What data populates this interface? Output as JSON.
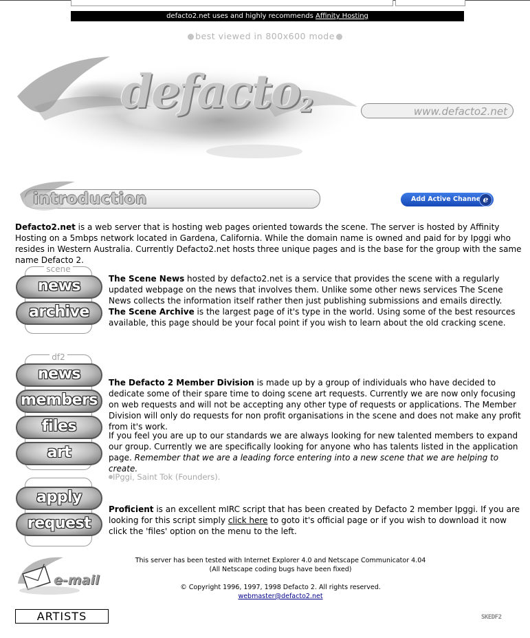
{
  "sponsor": {
    "text": "defacto2.net uses and highly recommends ",
    "link": "Affinity Hosting"
  },
  "best_viewed": "best viewed in 800x600 mode",
  "header": {
    "logo": "defacto",
    "logo_sub": "2",
    "url": "www.defacto2.net"
  },
  "intro": {
    "heading": "introduction",
    "channel_button": "Add Active Channel",
    "channel_icon": "e"
  },
  "intro_para": {
    "bold": "Defacto2.net",
    "text": " is a web server that is hosting web pages oriented towards the scene. The server is hosted by Affinity Hosting on a 5mbps network located in Gardena, California. While the domain name is owned and paid for by Ipggi who resides in Western Australia. Currently Defacto2.net hosts three unique pages and is the base for the group with the same name Defacto 2."
  },
  "nav": {
    "scene_label": "scene",
    "df2_label": "df2",
    "scene_news": "news",
    "scene_archive": "archive",
    "df2_news": "news",
    "df2_members": "members",
    "df2_files": "files",
    "df2_art": "art",
    "apply": "apply",
    "request": "request"
  },
  "scene": {
    "news_bold": "The Scene News",
    "news_text": " hosted by defacto2.net is a service that provides the scene with a regularly updated webpage on the news that involves them. Unlike some other news services The Scene News collects the information itself rather then just publishing submissions and emails directly.",
    "archive_bold": "The Scene Archive",
    "archive_text": " is the largest page of it's type in the world. Using some of the best resources available, this page should be your focal point if you wish to learn about the old cracking scene."
  },
  "df2": {
    "member_bold": "The Defacto 2 Member Division",
    "member_text": " is made up by a group of individuals who have decided to dedicate some of their spare time to doing scene art requests. Currently we are now only focusing on web requests and will not be accepting any other type of requests or applications. The Member Division will only do requests for non profit organisations in the scene and does not make any profit from it's work.",
    "standards_text": "If you feel you are up to our standards we are always looking for new talented members to expand our group. Currently we are specifically looking for anyone who has talents listed in the application page.",
    "standards_italic": "Remember that we are a leading force entering into a new scene that we are helping to create.",
    "founders": "IPggi, Saint Tok (Founders)."
  },
  "proficient": {
    "bold": "Proficient",
    "text1": " is an excellent mIRC script that has been created by Defacto 2 member Ipggi. If you are looking for this script simply ",
    "link": "click here",
    "text2": " to goto it's official page or if you wish to download it now click the 'files' option on the menu to the left."
  },
  "email_label": "e-mail",
  "footer": {
    "line1": "This server has been tested with Internet Explorer 4.0 and Netscape Communicator 4.04",
    "line2": "(All Netscape coding bugs have been fixed)",
    "copyright": "© Copyright 1996, 1997, 1998 Defacto 2. All rights reserved.",
    "email": "webmaster@defacto2.net"
  },
  "artists": "ARTISTS",
  "corner_tag": "SKEDF2"
}
